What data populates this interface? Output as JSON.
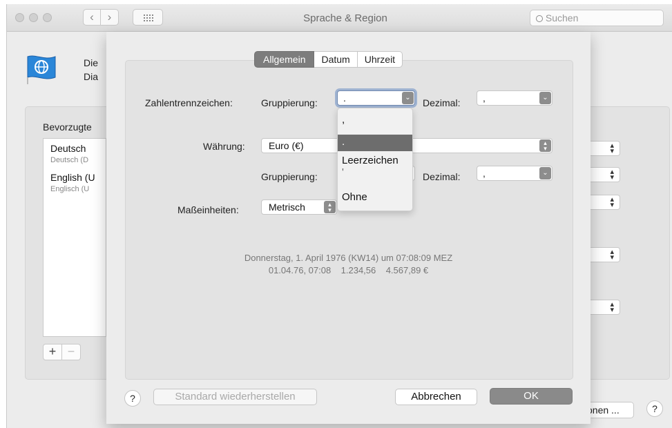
{
  "window": {
    "title": "Sprache & Region",
    "search_placeholder": "Suchen",
    "nav_back": "‹",
    "nav_forward": "›"
  },
  "header": {
    "line1": "Die",
    "line2": "Dia"
  },
  "preferred": {
    "title": "Bevorzugte",
    "languages": [
      {
        "name": "Deutsch",
        "sub": "Deutsch (D"
      },
      {
        "name": "English (U",
        "sub": "Englisch (U"
      }
    ],
    "add": "+",
    "remove": "−"
  },
  "background": {
    "advanced_label": "onen ...",
    "help": "?"
  },
  "sheet": {
    "tabs": [
      {
        "label": "Allgemein"
      },
      {
        "label": "Datum"
      },
      {
        "label": "Uhrzeit"
      }
    ],
    "number_separators_label": "Zahlentrennzeichen:",
    "grouping_label": "Gruppierung:",
    "grouping_value": ".",
    "decimal_label": "Dezimal:",
    "decimal_value": ",",
    "currency_label": "Währung:",
    "currency_value": "Euro (€)",
    "currency_grouping_label": "Gruppierung:",
    "currency_grouping_value": "'",
    "currency_decimal_label": "Dezimal:",
    "currency_decimal_value": ",",
    "units_label": "Maßeinheiten:",
    "units_value": "Metrisch",
    "grouping_menu": [
      {
        "label": ","
      },
      {
        "label": "."
      },
      {
        "label": "Leerzeichen"
      },
      {
        "label": "'"
      },
      {
        "label": "Ohne"
      }
    ],
    "preview_line1": "Donnerstag, 1. April 1976 (KW14) um 07:08:09 MEZ",
    "preview_line2": "01.04.76, 07:08    1.234,56    4.567,89 €",
    "help": "?",
    "restore_defaults": "Standard wiederherstellen",
    "cancel": "Abbrechen",
    "ok": "OK"
  }
}
